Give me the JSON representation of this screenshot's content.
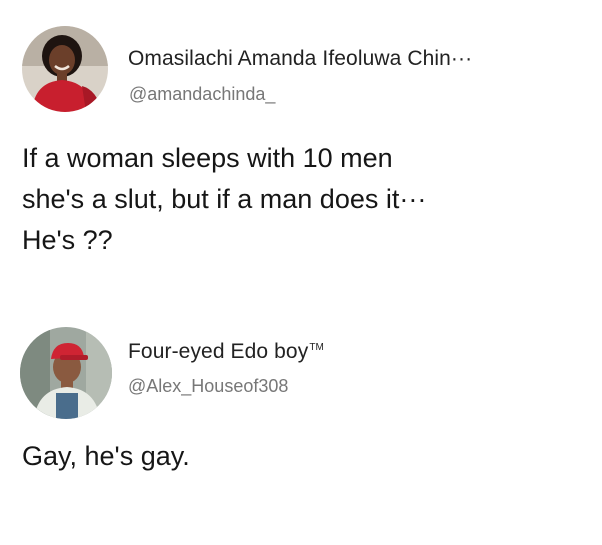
{
  "tweets": [
    {
      "display_name": "Omasilachi Amanda Ifeoluwa Chin···",
      "handle": "@amandachinda_",
      "text": "If a woman sleeps with 10 men\nshe's a slut, but if a man does it···\nHe's ??",
      "avatar_icon": "profile-photo-woman-red-top"
    },
    {
      "display_name": "Four-eyed Edo boy",
      "display_name_mark": "TM",
      "handle": "@Alex_Houseof308",
      "text": "Gay, he's gay.",
      "avatar_icon": "profile-photo-man-red-cap"
    }
  ],
  "colors": {
    "background": "#ffffff",
    "text": "#161616",
    "handle": "#777777"
  }
}
